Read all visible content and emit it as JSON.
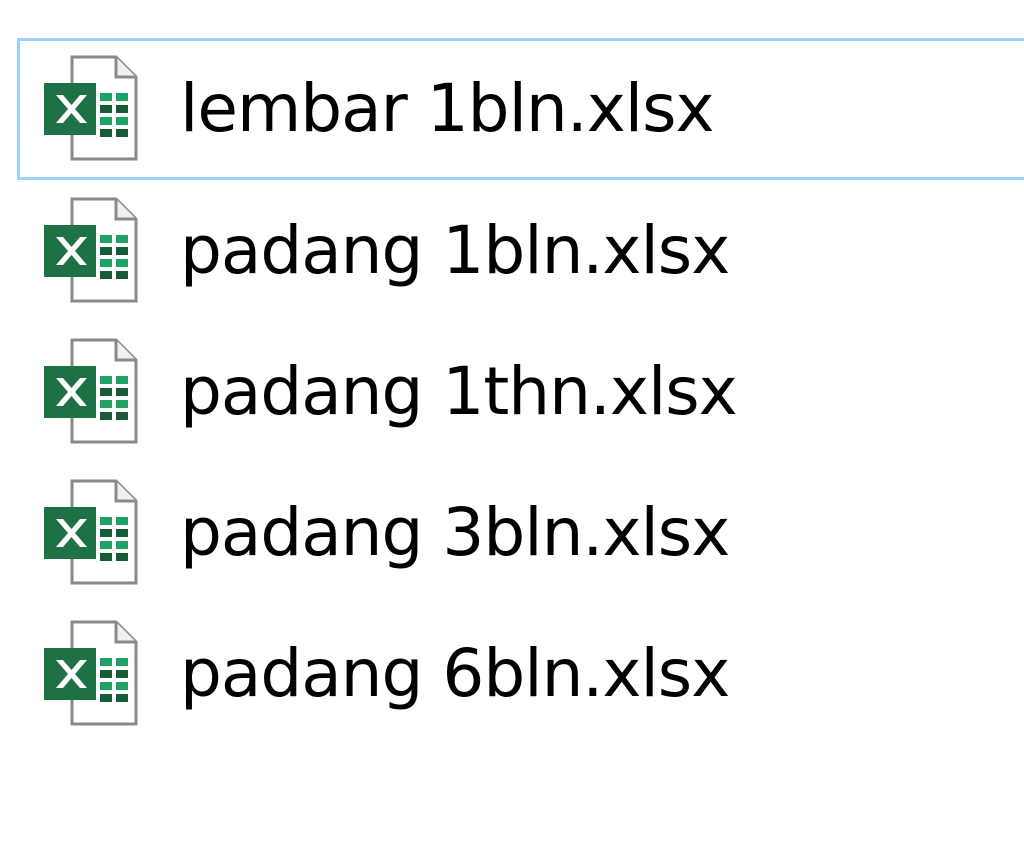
{
  "files": [
    {
      "name": "lembar 1bln.xlsx",
      "icon": "excel-file-icon",
      "focused": true
    },
    {
      "name": "padang 1bln.xlsx",
      "icon": "excel-file-icon",
      "focused": false
    },
    {
      "name": "padang 1thn.xlsx",
      "icon": "excel-file-icon",
      "focused": false
    },
    {
      "name": "padang 3bln.xlsx",
      "icon": "excel-file-icon",
      "focused": false
    },
    {
      "name": "padang 6bln.xlsx",
      "icon": "excel-file-icon",
      "focused": false
    }
  ],
  "colors": {
    "focus_border": "#99d1ff",
    "excel_green": "#1e7145",
    "excel_dark_green": "#185c37"
  }
}
